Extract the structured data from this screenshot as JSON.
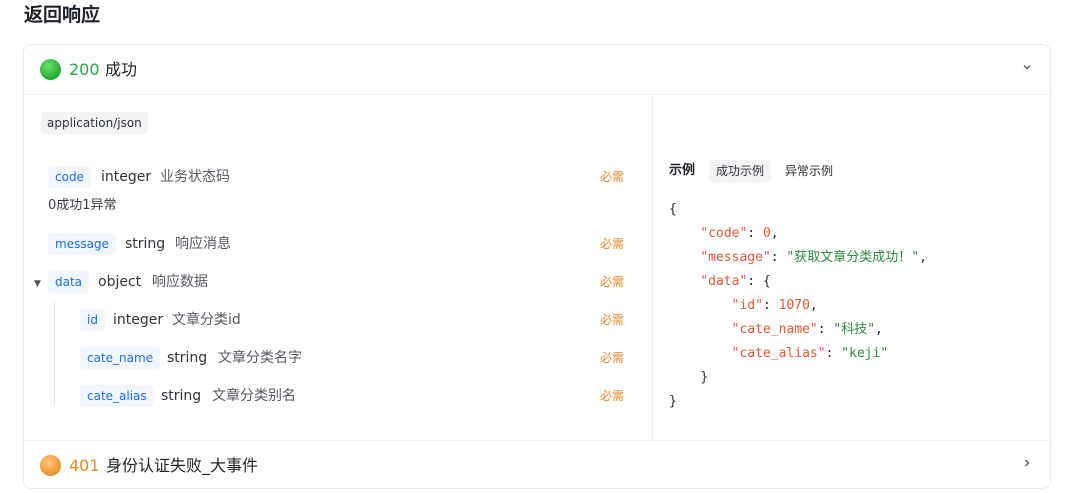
{
  "section_title": "返回响应",
  "responses": [
    {
      "code": "200",
      "text": "成功",
      "expanded": true,
      "status_color": "#23a845"
    },
    {
      "code": "401",
      "text": "身份认证失败_大事件",
      "expanded": false,
      "status_color": "#ea8a1f"
    }
  ],
  "content_type": "application/json",
  "fields": {
    "code": {
      "name": "code",
      "type": "integer",
      "desc": "业务状态码",
      "required": "必需",
      "note": "0成功1异常"
    },
    "message": {
      "name": "message",
      "type": "string",
      "desc": "响应消息",
      "required": "必需"
    },
    "data": {
      "name": "data",
      "type": "object",
      "desc": "响应数据",
      "required": "必需"
    },
    "id": {
      "name": "id",
      "type": "integer",
      "desc": "文章分类id",
      "required": "必需"
    },
    "cate_name": {
      "name": "cate_name",
      "type": "string",
      "desc": "文章分类名字",
      "required": "必需"
    },
    "cate_alias": {
      "name": "cate_alias",
      "type": "string",
      "desc": "文章分类别名",
      "required": "必需"
    }
  },
  "example": {
    "label": "示例",
    "tabs": [
      "成功示例",
      "异常示例"
    ],
    "active_tab": "成功示例",
    "json": {
      "open": "{",
      "code_key": "\"code\"",
      "code_val": "0",
      "message_key": "\"message\"",
      "message_val": "\"获取文章分类成功！\"",
      "data_key": "\"data\"",
      "data_open": "{",
      "id_key": "\"id\"",
      "id_val": "1070",
      "cate_name_key": "\"cate_name\"",
      "cate_name_val": "\"科技\"",
      "cate_alias_key": "\"cate_alias\"",
      "cate_alias_val": "\"keji\"",
      "data_close": "}",
      "close": "}"
    }
  },
  "icons": {
    "expand": "chevron-down-icon",
    "collapse": "chevron-right-icon",
    "tree_toggle": "caret-down-icon"
  }
}
